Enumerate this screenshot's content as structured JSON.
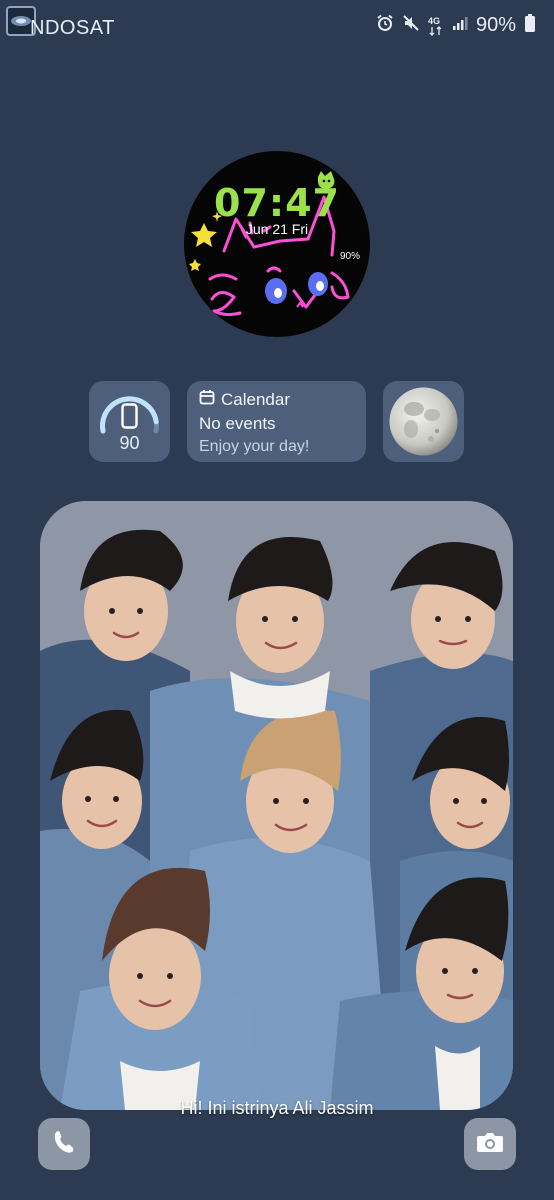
{
  "statusbar": {
    "carrier": "NDOSAT",
    "network_type": "4G",
    "battery_percent": "90%",
    "icons": [
      "app-logo-icon",
      "alarm-icon",
      "mute-icon",
      "network-4g-icon",
      "signal-icon",
      "battery-icon"
    ]
  },
  "clock": {
    "time": "07:47",
    "date": "Jun 21 Fri",
    "battery": "90%"
  },
  "widgets": {
    "battery": {
      "value": "90",
      "level": 0.9
    },
    "calendar": {
      "title": "Calendar",
      "line1": "No events",
      "line2": "Enjoy your day!"
    },
    "moon": {
      "icon": "full-moon-icon"
    }
  },
  "lockscreen": {
    "message": "Hi! Ini istrinya Ali Jassim"
  },
  "shortcuts": {
    "left_icon": "phone-icon",
    "right_icon": "camera-icon"
  },
  "colors": {
    "background": "#2c3a52",
    "widget": "#4d5f7b",
    "clock_time": "#9be24a",
    "doodle_pink": "#ff4fd8",
    "doodle_yellow": "#f5e03a"
  }
}
